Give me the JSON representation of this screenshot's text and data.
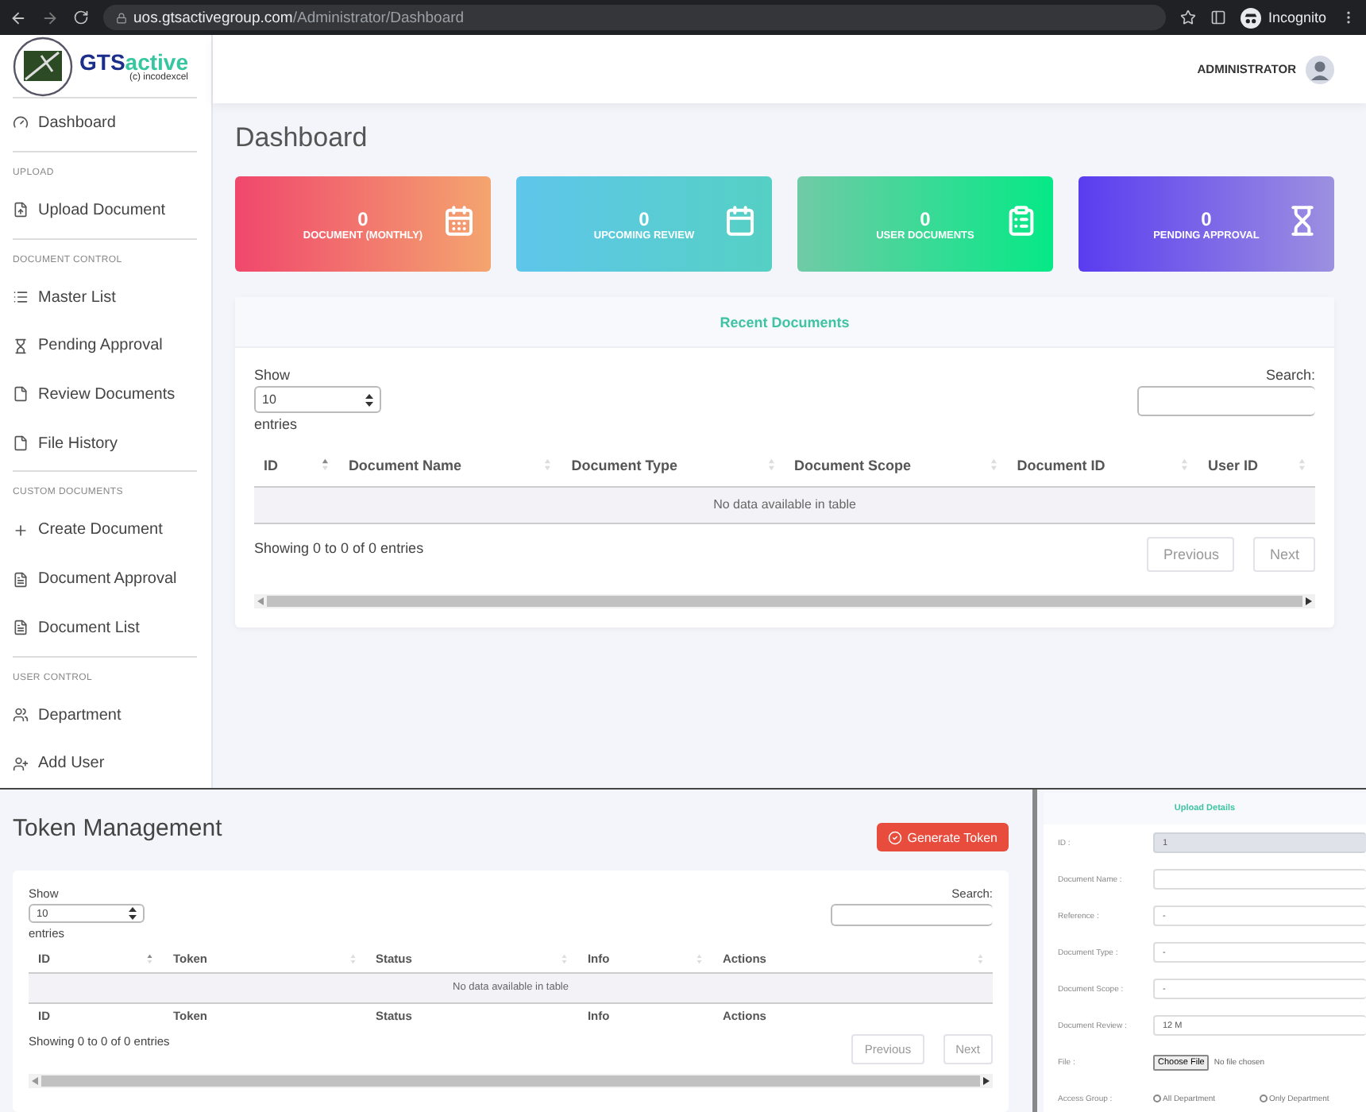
{
  "browser": {
    "url_host": "uos.gtsactivegroup.com",
    "url_path": "/Administrator/Dashboard",
    "profile": "Incognito"
  },
  "sidebar": {
    "logo": {
      "name_part_1": "GTS",
      "name_part_2": "active",
      "tagline": "(c) incodexcel"
    },
    "sections": [
      {
        "items": [
          {
            "label": "Dashboard"
          }
        ]
      },
      {
        "heading": "UPLOAD",
        "items": [
          {
            "label": "Upload Document"
          }
        ]
      },
      {
        "heading": "DOCUMENT CONTROL",
        "items": [
          {
            "label": "Master List"
          },
          {
            "label": "Pending Approval"
          },
          {
            "label": "Review Documents"
          },
          {
            "label": "File History"
          }
        ]
      },
      {
        "heading": "CUSTOM DOCUMENTS",
        "items": [
          {
            "label": "Create Document"
          },
          {
            "label": "Document Approval"
          },
          {
            "label": "Document List"
          }
        ]
      },
      {
        "heading": "USER CONTROL",
        "items": [
          {
            "label": "Department"
          },
          {
            "label": "Add User"
          }
        ]
      }
    ]
  },
  "header": {
    "user": "ADMINISTRATOR"
  },
  "page_title": "Dashboard",
  "cards": [
    {
      "value": "0",
      "label": "DOCUMENT (MONTHLY)",
      "color": "#f0476c"
    },
    {
      "value": "0",
      "label": "UPCOMING REVIEW",
      "color": "#5ec6ea"
    },
    {
      "value": "0",
      "label": "USER DOCUMENTS",
      "color": "#70caa6"
    },
    {
      "value": "0",
      "label": "PENDING APPROVAL",
      "color": "#5a3cf0"
    }
  ],
  "recent_documents": {
    "title": "Recent Documents",
    "table": {
      "show_label": "Show",
      "page_size": "10",
      "entries_label": "entries",
      "search_label": "Search:",
      "columns": [
        {
          "label": "ID",
          "sorted": true
        },
        {
          "label": "Document Name",
          "sorted": false
        },
        {
          "label": "Document Type",
          "sorted": false
        },
        {
          "label": "Document Scope",
          "sorted": false
        },
        {
          "label": "Document ID",
          "sorted": false
        },
        {
          "label": "User ID",
          "sorted": false
        }
      ],
      "empty_message": "No data available in table",
      "info": "Showing 0 to 0 of 0 entries",
      "previous": {
        "label": "Previous",
        "disabled": true
      },
      "next": {
        "label": "Next",
        "disabled": true
      }
    }
  },
  "token_management": {
    "title": "Token Management",
    "generate_button": "Generate Token",
    "table": {
      "show_label": "Show",
      "page_size": "10",
      "entries_label": "entries",
      "search_label": "Search:",
      "columns": [
        {
          "label": "ID",
          "sorted": true
        },
        {
          "label": "Token",
          "sorted": false
        },
        {
          "label": "Status",
          "sorted": false
        },
        {
          "label": "Info",
          "sorted": false
        },
        {
          "label": "Actions",
          "sorted": false
        }
      ],
      "empty_message": "No data available in table",
      "footer_columns": [
        "ID",
        "Token",
        "Status",
        "Info",
        "Actions"
      ],
      "info": "Showing 0 to 0 of 0 entries",
      "previous": {
        "label": "Previous",
        "disabled": true
      },
      "next": {
        "label": "Next",
        "disabled": true
      }
    }
  },
  "upload_details": {
    "title": "Upload Details",
    "fields": [
      {
        "kind": "text",
        "label": "ID :",
        "value": "1",
        "disabled": true
      },
      {
        "kind": "text",
        "label": "Document Name :",
        "disabled": false
      },
      {
        "kind": "text",
        "label": "Reference :",
        "value": "-",
        "disabled": false
      },
      {
        "kind": "text",
        "label": "Document Type :",
        "value": "-",
        "disabled": false
      },
      {
        "kind": "text",
        "label": "Document Scope :",
        "value": "-",
        "disabled": false
      },
      {
        "kind": "text",
        "label": "Document Review :",
        "value": "12 M",
        "disabled": false
      },
      {
        "kind": "file",
        "label": "File :",
        "button": "Choose File",
        "status": "No file chosen"
      },
      {
        "kind": "radio",
        "label": "Access Group :",
        "options": [
          {
            "label": "All Department",
            "selected": false
          },
          {
            "label": "Only Department",
            "selected": false
          }
        ]
      }
    ]
  }
}
